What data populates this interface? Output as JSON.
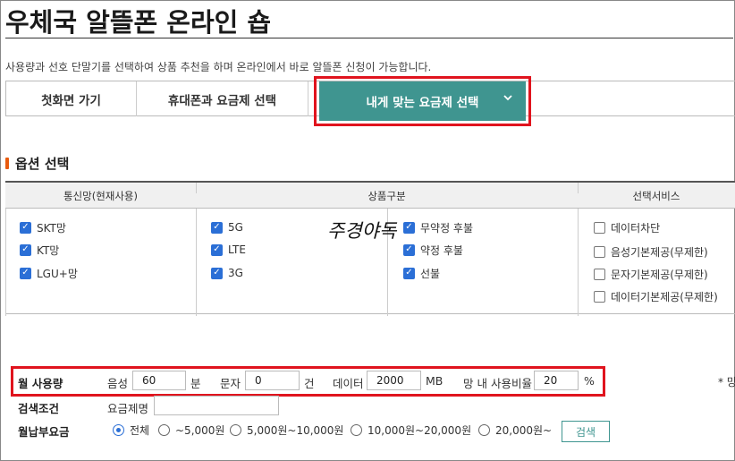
{
  "page": {
    "title": "우체국 알뜰폰 온라인 숍",
    "intro": "사용량과 선호 단말기를 선택하여 상품 추천을 하며 온라인에서 바로 알뜰폰 신청이 가능합니다."
  },
  "tabs": {
    "home": "첫화면 가기",
    "phone_plan": "휴대폰과 요금제 선택",
    "recommend": "내게 맞는 요금제 선택",
    "recommend_icon": "chevron-down-icon"
  },
  "options": {
    "section_title": "옵션 선택",
    "headers": {
      "network": "통신망(현재사용)",
      "product_type": "상품구분",
      "service": "선택서비스"
    },
    "network": [
      {
        "label": "SKT망",
        "checked": true
      },
      {
        "label": "KT망",
        "checked": true
      },
      {
        "label": "LGU+망",
        "checked": true
      }
    ],
    "generation": [
      {
        "label": "5G",
        "checked": true
      },
      {
        "label": "LTE",
        "checked": true
      },
      {
        "label": "3G",
        "checked": true
      }
    ],
    "contract": [
      {
        "label": "무약정 후불",
        "checked": true
      },
      {
        "label": "약정 후불",
        "checked": true
      },
      {
        "label": "선불",
        "checked": true
      }
    ],
    "services": [
      {
        "label": "데이터차단",
        "checked": false
      },
      {
        "label": "음성기본제공(무제한)",
        "checked": false
      },
      {
        "label": "문자기본제공(무제한)",
        "checked": false
      },
      {
        "label": "데이터기본제공(무제한)",
        "checked": false
      }
    ]
  },
  "watermark": "주경야독",
  "usage": {
    "label": "월 사용량",
    "voice_label": "음성",
    "voice_value": "60",
    "voice_unit": "분",
    "sms_label": "문자",
    "sms_value": "0",
    "sms_unit": "건",
    "data_label": "데이터",
    "data_value": "2000",
    "data_unit": "MB",
    "ratio_label": "망 내 사용비율",
    "ratio_value": "20",
    "ratio_unit": "%"
  },
  "search": {
    "label": "검색조건",
    "plan_name_label": "요금제명",
    "plan_name_value": ""
  },
  "fee": {
    "label": "월납부요금",
    "options": [
      "전체",
      "~5,000원",
      "5,000원~10,000원",
      "10,000원~20,000원",
      "20,000원~"
    ],
    "selected": "전체",
    "search_button": "검색"
  },
  "side_note": "* 망"
}
